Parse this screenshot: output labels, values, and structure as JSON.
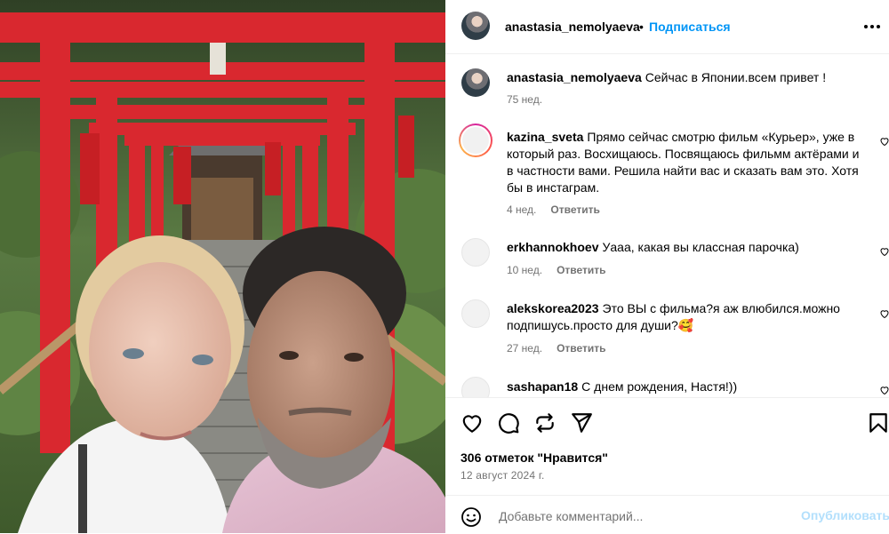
{
  "post": {
    "author": "anastasia_nemolyaeva",
    "separator": "•",
    "follow_label": "Подписаться",
    "caption": {
      "user": "anastasia_nemolyaeva",
      "text": "Сейчас в Японии.всем привет !",
      "time": "75 нед."
    }
  },
  "comments": [
    {
      "user": "kazina_sveta",
      "text": "Прямо сейчас смотрю фильм «Курьер», уже в который раз. Восхищаюсь. Посвящаюсь фильмм актёрами и в частности вами. Решила найти вас и сказать вам это. Хотя бы в инстаграм.",
      "time": "4 нед.",
      "reply_label": "Ответить"
    },
    {
      "user": "erkhannokhoev",
      "text": "Уааа, какая вы классная парочка)",
      "time": "10 нед.",
      "reply_label": "Ответить"
    },
    {
      "user": "alekskorea2023",
      "text": "Это ВЫ с фильма?я аж влюбился.можно подпишусь.просто для души?🥰",
      "time": "27 нед.",
      "reply_label": "Ответить"
    },
    {
      "user": "sashapan18",
      "text": "С днем рождения, Настя!))",
      "time": "",
      "reply_label": ""
    }
  ],
  "stats": {
    "likes": "306 отметок \"Нравится\"",
    "date": "12 август 2024 г."
  },
  "add_comment": {
    "placeholder": "Добавьте комментарий...",
    "publish_label": "Опубликовать"
  },
  "icons": {
    "more": "more-horizontal-icon",
    "like": "heart-icon",
    "comment": "comment-icon",
    "share": "share-icon",
    "send": "send-icon",
    "save": "bookmark-icon",
    "emoji": "emoji-icon"
  },
  "colors": {
    "accent": "#0095f6",
    "publish_disabled": "#b2dffc",
    "muted": "#737373",
    "torii_red": "#d9282f"
  }
}
